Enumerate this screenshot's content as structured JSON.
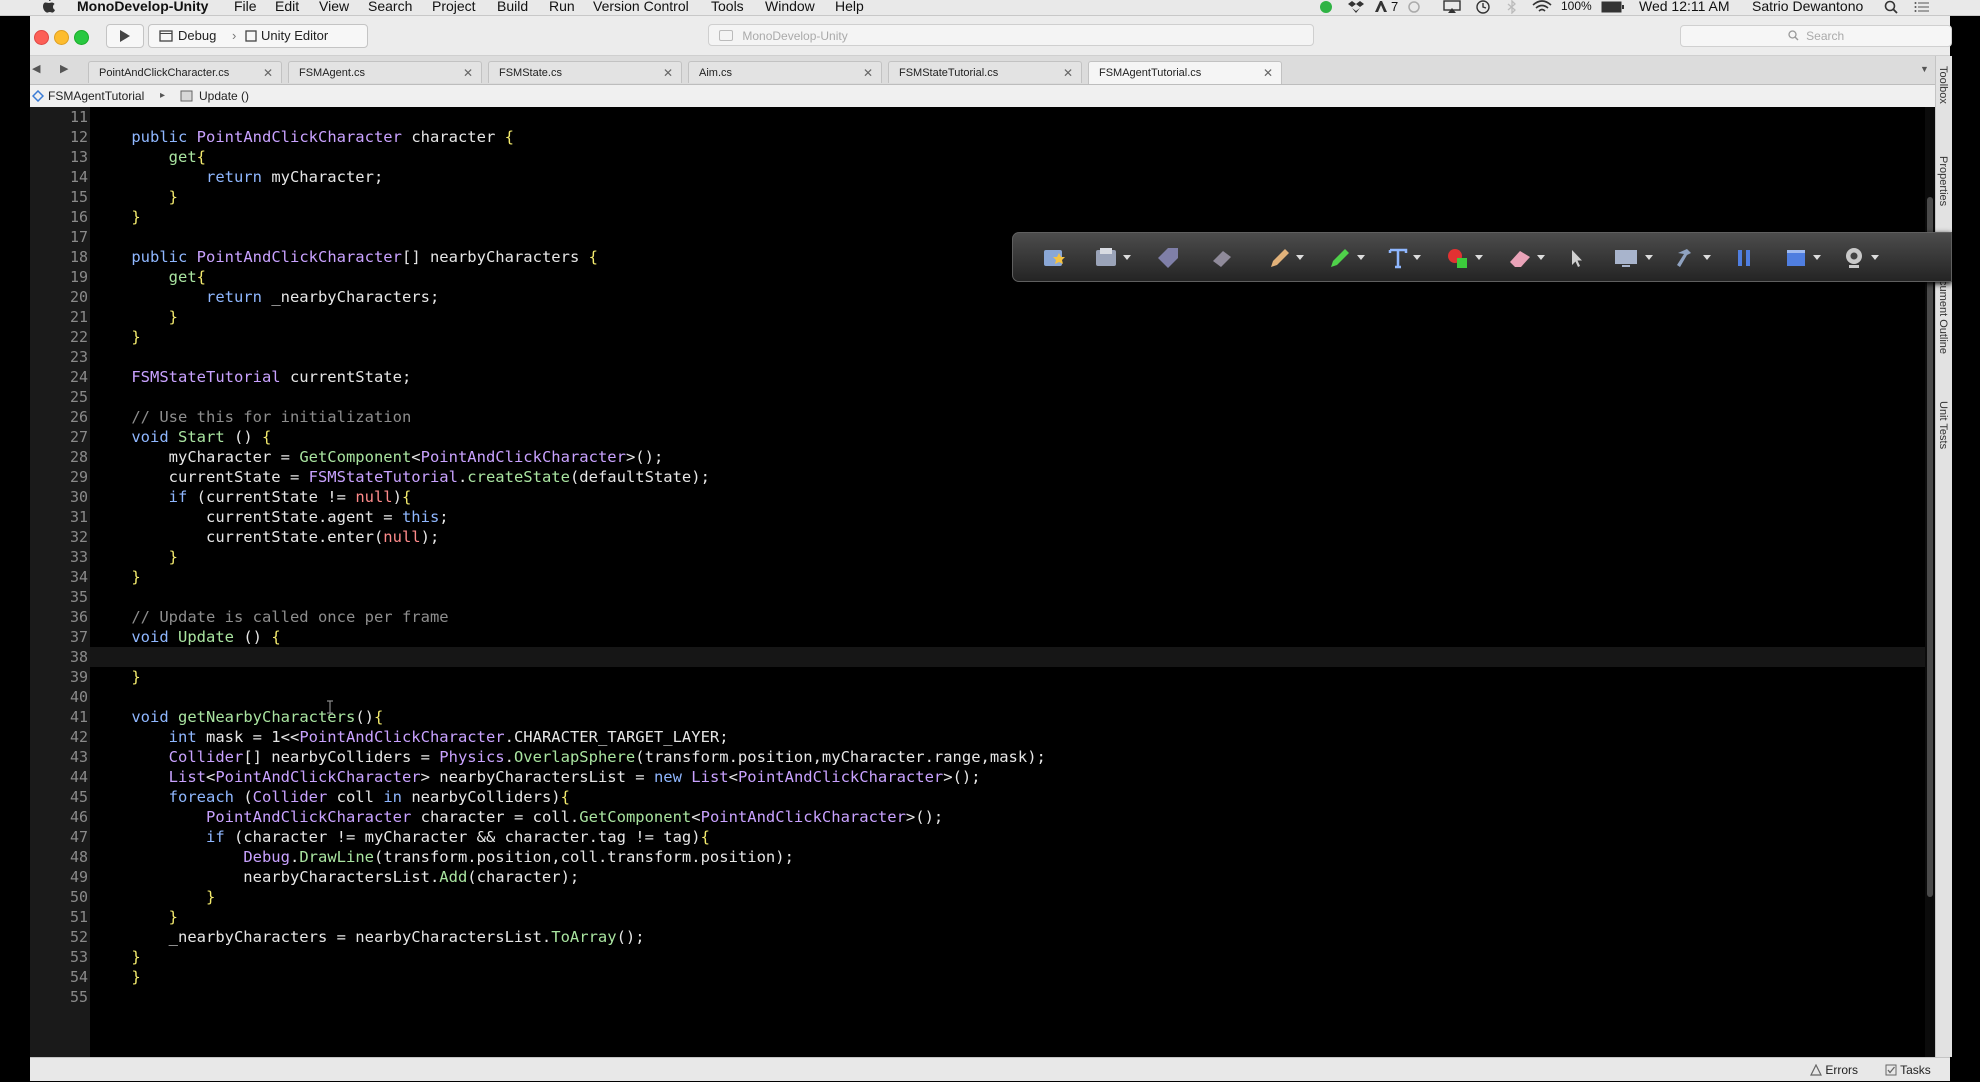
{
  "menubar": {
    "apple": "",
    "app_name": "MonoDevelop-Unity",
    "items": [
      "File",
      "Edit",
      "View",
      "Search",
      "Project",
      "Build",
      "Run",
      "Version Control",
      "Tools",
      "Window",
      "Help"
    ],
    "status": {
      "badge": "7",
      "battery": "100%",
      "datetime": "Wed 12:11 AM",
      "user": "Satrio Dewantono"
    }
  },
  "toolbar": {
    "config": "Debug",
    "separator": "›",
    "target": "Unity Editor",
    "status_text": "MonoDevelop-Unity",
    "search_placeholder": "Search"
  },
  "tabs": [
    {
      "label": "PointAndClickCharacter.cs",
      "active": false
    },
    {
      "label": "FSMAgent.cs",
      "active": false
    },
    {
      "label": "FSMState.cs",
      "active": false
    },
    {
      "label": "Aim.cs",
      "active": false
    },
    {
      "label": "FSMStateTutorial.cs",
      "active": false
    },
    {
      "label": "FSMAgentTutorial.cs",
      "active": true
    }
  ],
  "pathbar": {
    "class_name": "FSMAgentTutorial",
    "arrow": "▸",
    "method_name": "Update ()"
  },
  "side_panel": [
    "Toolbox",
    "Properties",
    "Document Outline",
    "Unit Tests"
  ],
  "statusbar": {
    "errors": "Errors",
    "tasks": "Tasks"
  },
  "editor": {
    "current_line": 38,
    "lines": [
      {
        "n": "11",
        "t": ""
      },
      {
        "n": "12",
        "t": "public PointAndClickCharacter character {"
      },
      {
        "n": "13",
        "t": "    get{"
      },
      {
        "n": "14",
        "t": "        return myCharacter;"
      },
      {
        "n": "15",
        "t": "    }"
      },
      {
        "n": "16",
        "t": "}"
      },
      {
        "n": "17",
        "t": ""
      },
      {
        "n": "18",
        "t": "public PointAndClickCharacter[] nearbyCharacters {"
      },
      {
        "n": "19",
        "t": "    get{"
      },
      {
        "n": "20",
        "t": "        return _nearbyCharacters;"
      },
      {
        "n": "21",
        "t": "    }"
      },
      {
        "n": "22",
        "t": "}"
      },
      {
        "n": "23",
        "t": ""
      },
      {
        "n": "24",
        "t": "FSMStateTutorial currentState;"
      },
      {
        "n": "25",
        "t": ""
      },
      {
        "n": "26",
        "t": "// Use this for initialization"
      },
      {
        "n": "27",
        "t": "void Start () {"
      },
      {
        "n": "28",
        "t": "    myCharacter = GetComponent<PointAndClickCharacter>();"
      },
      {
        "n": "29",
        "t": "    currentState = FSMStateTutorial.createState(defaultState);"
      },
      {
        "n": "30",
        "t": "    if (currentState != null){"
      },
      {
        "n": "31",
        "t": "        currentState.agent = this;"
      },
      {
        "n": "32",
        "t": "        currentState.enter(null);"
      },
      {
        "n": "33",
        "t": "    }"
      },
      {
        "n": "34",
        "t": "}"
      },
      {
        "n": "35",
        "t": ""
      },
      {
        "n": "36",
        "t": "// Update is called once per frame"
      },
      {
        "n": "37",
        "t": "void Update () {"
      },
      {
        "n": "38",
        "t": ""
      },
      {
        "n": "39",
        "t": "}"
      },
      {
        "n": "40",
        "t": ""
      },
      {
        "n": "41",
        "t": "void getNearbyCharacters(){"
      },
      {
        "n": "42",
        "t": "    int mask = 1<<PointAndClickCharacter.CHARACTER_TARGET_LAYER;"
      },
      {
        "n": "43",
        "t": "    Collider[] nearbyColliders = Physics.OverlapSphere(transform.position,myCharacter.range,mask);"
      },
      {
        "n": "44",
        "t": "    List<PointAndClickCharacter> nearbyCharactersList = new List<PointAndClickCharacter>();"
      },
      {
        "n": "45",
        "t": "    foreach (Collider coll in nearbyColliders){"
      },
      {
        "n": "46",
        "t": "        PointAndClickCharacter character = coll.GetComponent<PointAndClickCharacter>();"
      },
      {
        "n": "47",
        "t": "        if (character != myCharacter && character.tag != tag){"
      },
      {
        "n": "48",
        "t": "            Debug.DrawLine(transform.position,coll.transform.position);"
      },
      {
        "n": "49",
        "t": "            nearbyCharactersList.Add(character);"
      },
      {
        "n": "50",
        "t": "        }"
      },
      {
        "n": "51",
        "t": "    }"
      },
      {
        "n": "52",
        "t": "    _nearbyCharacters = nearbyCharactersList.ToArray();"
      },
      {
        "n": "53",
        "t": "}"
      },
      {
        "n": "54",
        "t": "}"
      },
      {
        "n": "55",
        "t": ""
      }
    ]
  },
  "colors": {
    "keyword": "#8fb7ff",
    "type": "#c9a2ff",
    "method": "#a9e4a0",
    "comment": "#8d8d8d",
    "null_literal": "#ff8b8b",
    "brace": "#f3ea6d"
  }
}
